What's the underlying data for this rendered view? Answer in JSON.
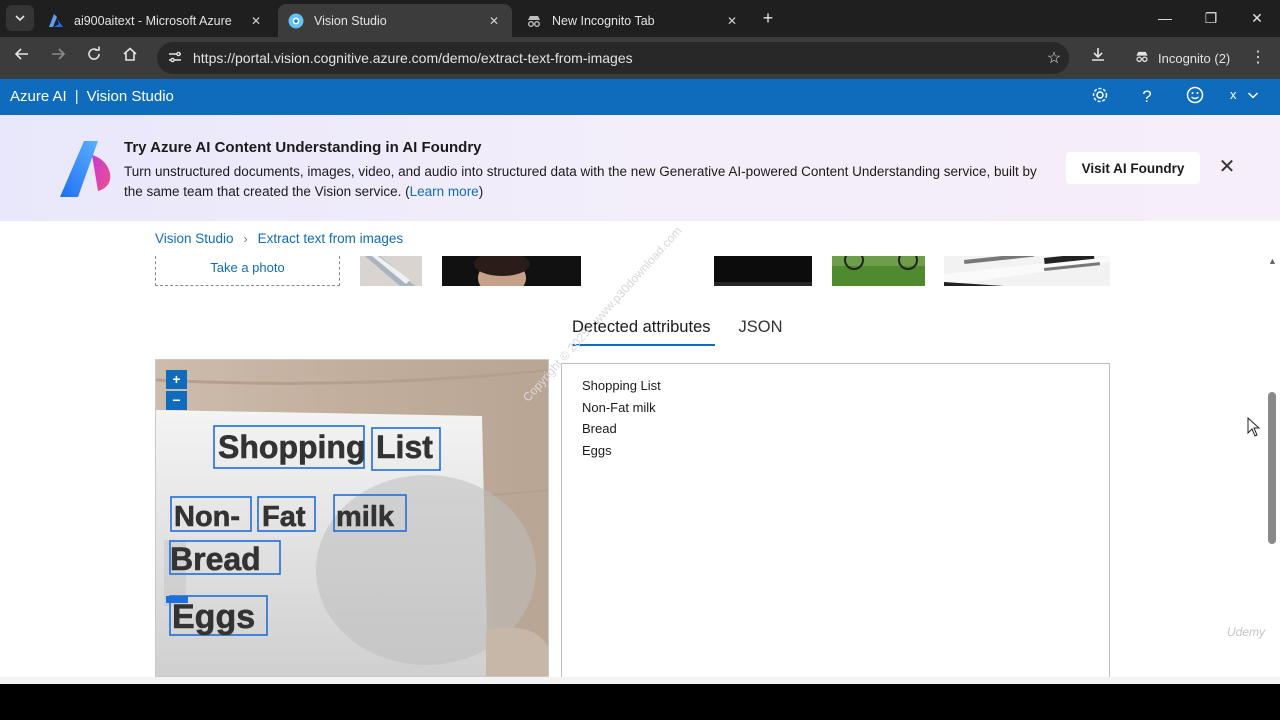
{
  "browser": {
    "tabs": [
      {
        "title": "ai900aitext - Microsoft Azure",
        "active": false
      },
      {
        "title": "Vision Studio",
        "active": true
      },
      {
        "title": "New Incognito Tab",
        "active": false
      }
    ],
    "url": "https://portal.vision.cognitive.azure.com/demo/extract-text-from-images",
    "incognito_label": "Incognito (2)"
  },
  "header": {
    "brand_left": "Azure AI",
    "brand_sep": "|",
    "brand_right": "Vision Studio",
    "user_initial": "x",
    "icons": [
      "gear-icon",
      "help-icon",
      "smiley-icon"
    ]
  },
  "banner": {
    "title": "Try Azure AI Content Understanding in AI Foundry",
    "body": "Turn unstructured documents, images, video, and audio into structured data with the new Generative AI-powered Content Understanding service, built by the same team that created the Vision service. (",
    "link": "Learn more",
    "body_end": ")",
    "button": "Visit AI Foundry"
  },
  "breadcrumb": {
    "root": "Vision Studio",
    "current": "Extract text from images"
  },
  "samples": {
    "take_photo": "Take a photo"
  },
  "tabs": {
    "detected": "Detected attributes",
    "json": "JSON"
  },
  "image": {
    "zoom_in": "+",
    "zoom_out": "−",
    "words": [
      "Shopping",
      "List",
      "Non-",
      "Fat",
      "milk",
      "Bread",
      "Eggs"
    ]
  },
  "results": {
    "lines": [
      "Shopping List",
      "Non-Fat milk",
      "Bread",
      "Eggs"
    ]
  },
  "watermark": {
    "udemy": "Udemy",
    "diagonal": "Copyright © 2025 - www.p30download.com"
  },
  "colors": {
    "azure_blue": "#0f6cbd",
    "chrome_dark": "#1f1f1f",
    "chrome_toolbar": "#3c3c3c"
  }
}
